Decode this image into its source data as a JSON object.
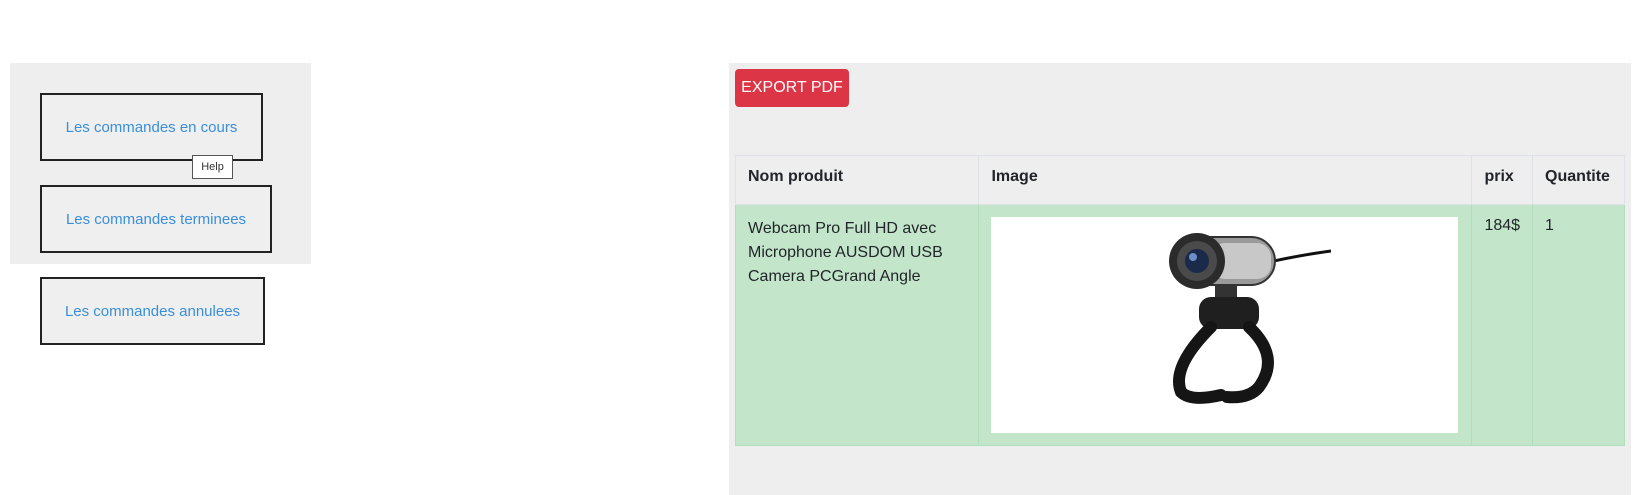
{
  "nav": {
    "en_cours": "Les commandes en cours",
    "terminees": "Les commandes terminees",
    "annulees": "Les commandes annulees",
    "tooltip": "Help"
  },
  "toolbar": {
    "export_label": "EXPORT PDF"
  },
  "table": {
    "headers": {
      "name": "Nom produit",
      "image": "Image",
      "price": "prix",
      "qty": "Quantite"
    },
    "rows": [
      {
        "name": "Webcam Pro Full HD avec Microphone AUSDOM USB Camera PCGrand Angle",
        "image_icon": "webcam-product-image",
        "price": "184$",
        "qty": "1"
      }
    ]
  },
  "colors": {
    "export_button": "#dc3545",
    "success_row": "#c3e6cb",
    "link": "#3a8fd9",
    "panel_bg": "#eeeeee"
  }
}
